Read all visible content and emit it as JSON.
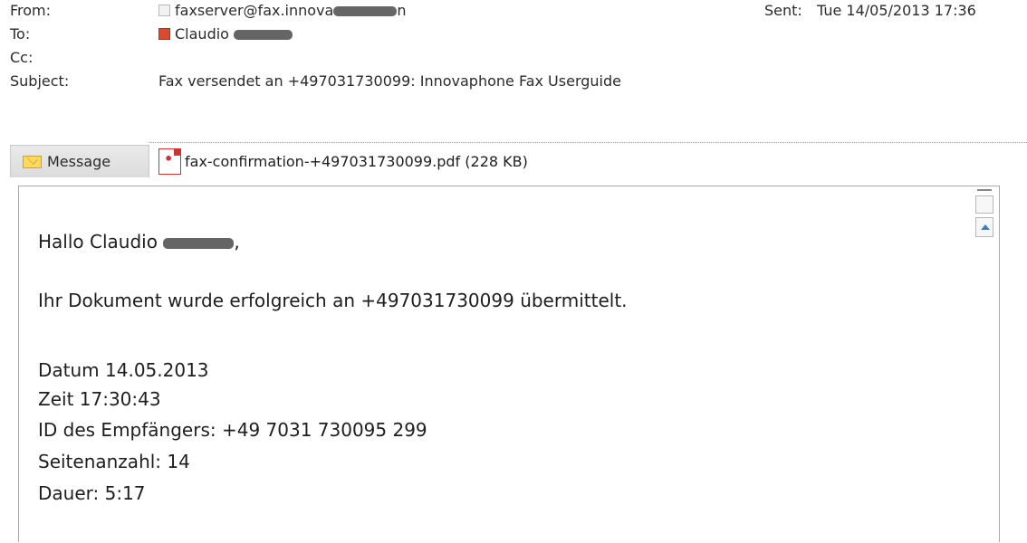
{
  "header": {
    "from_label": "From:",
    "from_value": "faxserver@fax.innova",
    "from_value_tail": "n",
    "sent_label": "Sent:",
    "sent_value": "Tue 14/05/2013 17:36",
    "to_label": "To:",
    "to_value": "Claudio",
    "cc_label": "Cc:",
    "subject_label": "Subject:",
    "subject_value": "Fax versendet an +497031730099: Innovaphone Fax Userguide"
  },
  "tabs": {
    "message_label": "Message",
    "attachment_label": "fax-confirmation-+497031730099.pdf (228 KB)"
  },
  "body": {
    "greeting_prefix": "Hallo Claudio",
    "greeting_suffix": ",",
    "line_sent": "Ihr Dokument wurde erfolgreich an +497031730099 übermittelt.",
    "line_date": "Datum 14.05.2013",
    "line_time": "Zeit 17:30:43",
    "line_recipient_id": "ID des Empfängers: +49 7031 730095 299",
    "line_pages": "Seitenanzahl: 14",
    "line_duration": "Dauer: 5:17"
  },
  "icons": {
    "message": "envelope-icon",
    "attachment": "pdf-icon",
    "contact_from": "contact-status-gray-icon",
    "contact_to": "contact-status-red-icon",
    "scroll_up": "scroll-up-arrow-icon",
    "split": "split-view-icon"
  },
  "colors": {
    "pdf_red": "#cc3333",
    "contact_red": "#d94a30",
    "envelope_yellow": "#ffd95a",
    "scroll_arrow_blue": "#3c7fbf"
  }
}
